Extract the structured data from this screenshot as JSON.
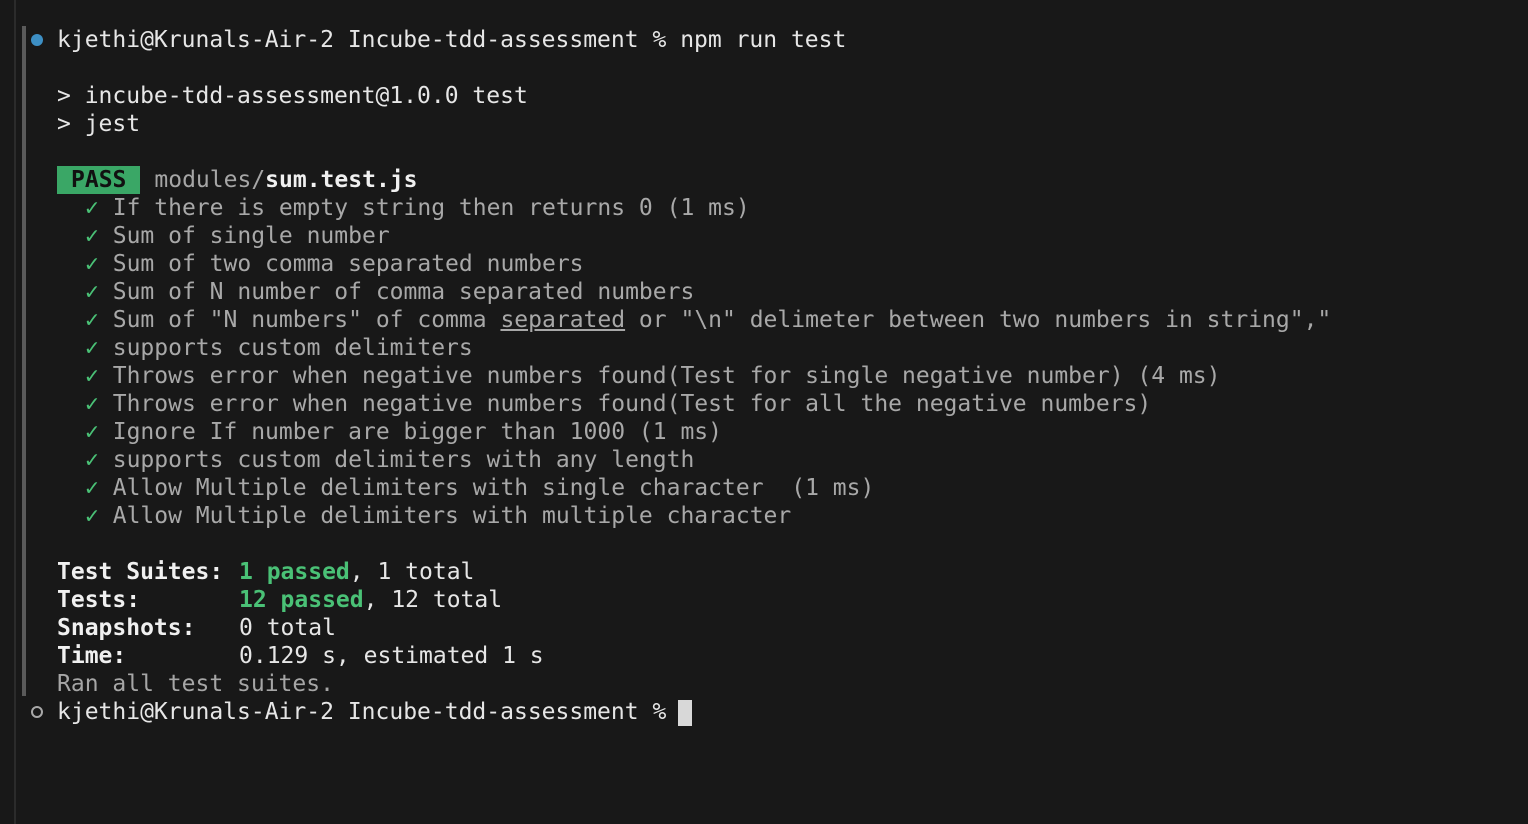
{
  "prompt": {
    "user_host": "kjethi@Krunals-Air-2",
    "cwd": "Incube-tdd-assessment",
    "symbol": "%",
    "command": "npm run test"
  },
  "script_lines": [
    "> incube-tdd-assessment@1.0.0 test",
    "> jest"
  ],
  "suite": {
    "badge": "PASS",
    "path_dir": "modules/",
    "path_file": "sum.test.js"
  },
  "check_glyph": "✓",
  "tests": [
    "If there is empty string then returns 0 (1 ms)",
    "Sum of single number",
    "Sum of two comma separated numbers",
    "Sum of N number of comma separated numbers",
    "supports custom delimiters",
    "Throws error when negative numbers found(Test for single negative number) (4 ms)",
    "Throws error when negative numbers found(Test for all the negative numbers)",
    "Ignore If number are bigger than 1000 (1 ms)",
    "supports custom delimiters with any length",
    "Allow Multiple delimiters with single character  (1 ms)",
    "Allow Multiple delimiters with multiple character"
  ],
  "test_special": {
    "before": "Sum of \"N numbers\" of comma ",
    "underlined": "separated",
    "after": " or \"\\n\" delimeter between two numbers in string\",\""
  },
  "summary": {
    "suites_label": "Test Suites:",
    "suites_passed": "1 passed",
    "suites_total": ", 1 total",
    "tests_label": "Tests:",
    "tests_passed": "12 passed",
    "tests_total": ", 12 total",
    "snapshots_label": "Snapshots:",
    "snapshots_value": "0 total",
    "time_label": "Time:",
    "time_value": "0.129 s, estimated 1 s",
    "ran_all": "Ran all test suites."
  },
  "colors": {
    "background": "#181818",
    "pass_badge": "#3aa766",
    "check_green": "#4ac176",
    "success_dot": "#3d8fc4"
  }
}
